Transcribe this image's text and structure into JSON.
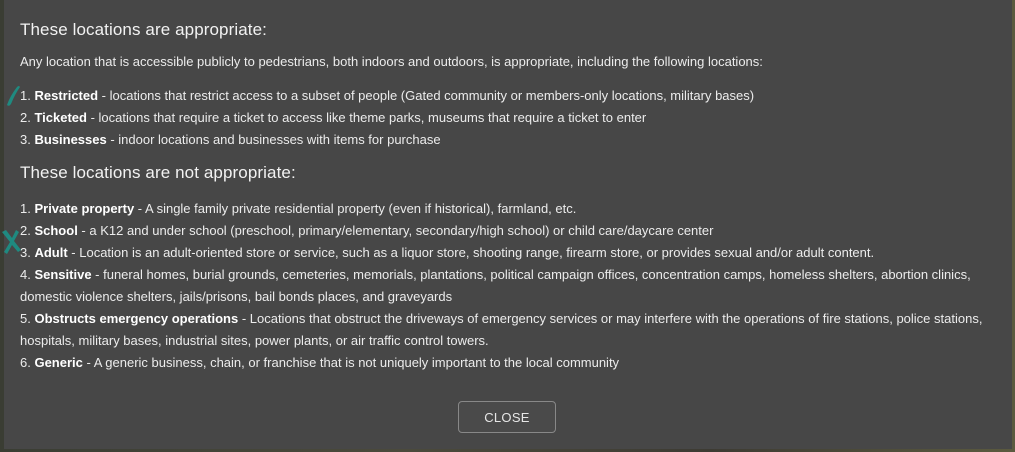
{
  "appropriate": {
    "title": "These locations are appropriate:",
    "intro": "Any location that is accessible publicly to pedestrians, both indoors and outdoors, is appropriate, including the following locations:",
    "items": [
      {
        "num": "1.",
        "name": "Restricted",
        "desc": " - locations that restrict access to a subset of people (Gated community or members-only locations, military bases)"
      },
      {
        "num": "2.",
        "name": "Ticketed",
        "desc": " - locations that require a ticket to access like theme parks, museums that require a ticket to enter"
      },
      {
        "num": "3.",
        "name": "Businesses",
        "desc": " - indoor locations and businesses with items for purchase"
      }
    ]
  },
  "not_appropriate": {
    "title": "These locations are not appropriate:",
    "items": [
      {
        "num": "1.",
        "name": "Private property",
        "desc": " - A single family private residential property (even if historical), farmland, etc."
      },
      {
        "num": "2.",
        "name": "School",
        "desc": " - a K12 and under school (preschool, primary/elementary, secondary/high school) or child care/daycare center"
      },
      {
        "num": "3.",
        "name": "Adult",
        "desc": " - Location is an adult-oriented store or service, such as a liquor store, shooting range, firearm store, or provides sexual and/or adult content."
      },
      {
        "num": "4.",
        "name": "Sensitive",
        "desc": " - funeral homes, burial grounds, cemeteries, memorials, plantations, political campaign offices, concentration camps, homeless shelters, abortion clinics, domestic violence shelters, jails/prisons, bail bonds places, and graveyards"
      },
      {
        "num": "5.",
        "name": "Obstructs emergency operations",
        "desc": " - Locations that obstruct the driveways of emergency services or may interfere with the operations of fire stations, police stations, hospitals, military bases, industrial sites, power plants, or air traffic control towers."
      },
      {
        "num": "6.",
        "name": "Generic",
        "desc": " - A generic business, chain, or franchise that is not uniquely important to the local community"
      }
    ]
  },
  "close_label": "CLOSE",
  "colors": {
    "modal_bg": "#474747",
    "text": "#ececec",
    "accent_teal": "#1f8a80"
  },
  "icons": {
    "appropriate_marker": "check-mark-icon",
    "not_appropriate_marker": "x-mark-icon"
  }
}
